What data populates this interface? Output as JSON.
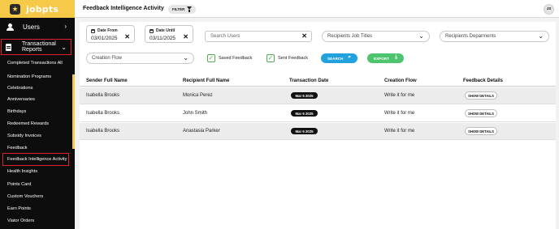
{
  "brand": {
    "name": "jobpts",
    "badge": "★"
  },
  "sidebar": {
    "users_label": "Users",
    "users_chevron": "›",
    "reports_label_line1": "Transactional",
    "reports_label_line2": "Reports",
    "reports_chevron": "⌄",
    "items": [
      "Completed Transactions All",
      "Nomination Programs",
      "Celebrations",
      "Anniversaries",
      "Birthdays",
      "Redeemed Rewards",
      "Subsidy Invoices",
      "Feedback",
      "Feedback Intelligence Activity",
      "Health Insights",
      "Points Card",
      "Custom Vouchers",
      "Earn Points",
      "Viator Orders"
    ],
    "active_item": "Feedback Intelligence Activity"
  },
  "header": {
    "title": "Feedback Intelligence Activity",
    "filter_label": "FILTER",
    "avatar_initials": "JS"
  },
  "filters": {
    "date_from": {
      "label": "Date From",
      "value": "03/01/2025"
    },
    "date_until": {
      "label": "Date Until",
      "value": "03/11/2025"
    },
    "clear_glyph": "✕",
    "search_users_placeholder": "Search Users",
    "job_titles_placeholder": "Recipients Job Titles",
    "departments_placeholder": "Recipients Deparments",
    "creation_flow_placeholder": "Creation Flow",
    "select_chevron": "⌄",
    "saved_feedback_label": "Saved Feedback",
    "sent_feedback_label": "Sent Feedback",
    "check_glyph": "✓",
    "search_button": "SEARCH",
    "export_button": "EXPORT",
    "search_icon": "⌕",
    "export_icon": "⤓"
  },
  "table": {
    "columns": [
      "Sender Full Name",
      "Recipient Full Name",
      "Transaction Date",
      "Creation Flow",
      "Feedback Details"
    ],
    "rows": [
      {
        "sender": "Isabella Brooks",
        "recipient": "Monica Perez",
        "date": "Mar 6 2025",
        "flow": "Write it for me",
        "action": "SHOW DETAILS"
      },
      {
        "sender": "Isabella Brooks",
        "recipient": "John Smith",
        "date": "Mar 6 2025",
        "flow": "Write it for me",
        "action": "SHOW DETAILS"
      },
      {
        "sender": "Isabella Brooks",
        "recipient": "Anastasia Parker",
        "date": "Mar 6 2025",
        "flow": "Write it for me",
        "action": "SHOW DETAILS"
      }
    ]
  },
  "colors": {
    "brand_yellow": "#f7c948",
    "highlight_red": "#e2212d",
    "search_blue": "#22a1dc",
    "export_green": "#4fc46f"
  }
}
